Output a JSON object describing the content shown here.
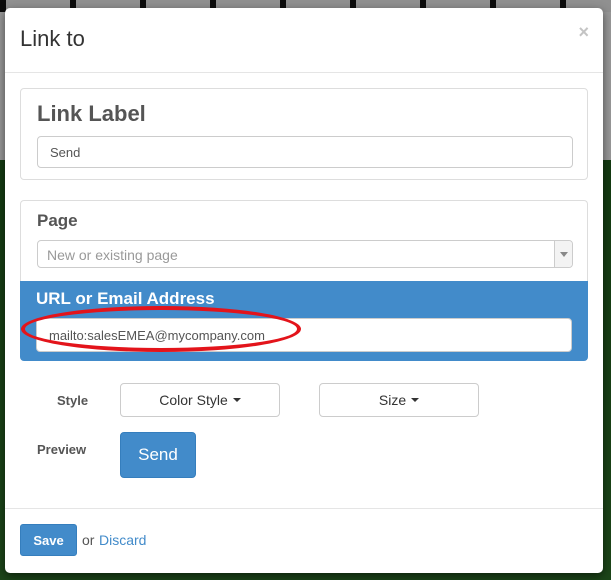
{
  "modal": {
    "title": "Link to",
    "close_symbol": "×"
  },
  "link_label": {
    "heading": "Link Label",
    "value": "Send"
  },
  "page": {
    "heading": "Page",
    "placeholder": "New or existing page"
  },
  "url": {
    "heading": "URL or Email Address",
    "value": "mailto:salesEMEA@mycompany.com"
  },
  "style": {
    "label": "Style",
    "color_style_button": "Color Style",
    "size_button": "Size"
  },
  "preview": {
    "label": "Preview",
    "button_label": "Send"
  },
  "footer": {
    "save_label": "Save",
    "or_text": "or",
    "discard_label": "Discard"
  },
  "colors": {
    "primary": "#428bca",
    "highlight": "#e3141b"
  }
}
